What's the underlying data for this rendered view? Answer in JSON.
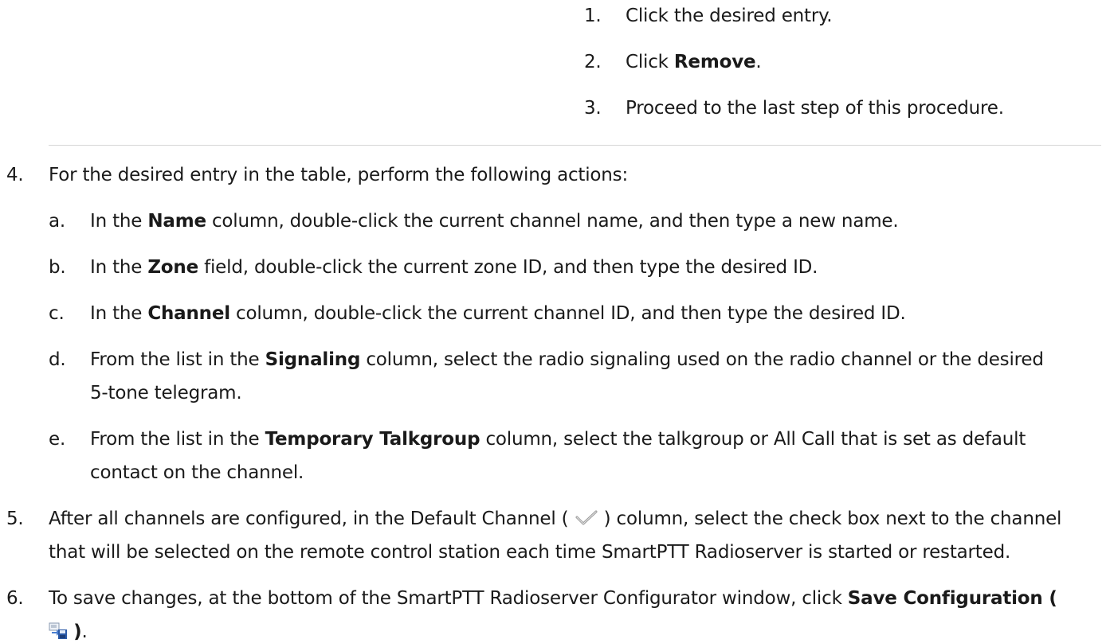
{
  "top_steps": [
    {
      "num": "1.",
      "text": "Click the desired entry."
    },
    {
      "num": "2.",
      "pre": "Click ",
      "bold": "Remove",
      "post": "."
    },
    {
      "num": "3.",
      "text": "Proceed to the last step of this procedure."
    }
  ],
  "step4": {
    "num": "4.",
    "text": "For the desired entry in the table, perform the following actions:",
    "substeps": [
      {
        "letter": "a.",
        "pre": "In the ",
        "bold": "Name",
        "post": " column, double-click the current channel name, and then type a new name."
      },
      {
        "letter": "b.",
        "pre": "In the ",
        "bold": "Zone",
        "post": " field, double-click the current zone ID, and then type the desired ID."
      },
      {
        "letter": "c.",
        "pre": "In the ",
        "bold": "Channel",
        "post": " column, double-click the current channel ID, and then type the desired ID."
      },
      {
        "letter": "d.",
        "pre": "From the list in the ",
        "bold": "Signaling",
        "post": " column, select the radio signaling used on the radio channel or the desired",
        "line2": "5-tone telegram."
      },
      {
        "letter": "e.",
        "pre": "From the list in the ",
        "bold": "Temporary Talkgroup",
        "post": " column, select the talkgroup or All Call that is set as default",
        "line2": "contact on the channel."
      }
    ]
  },
  "step5": {
    "num": "5.",
    "pre": "After all channels are configured, in the Default Channel (",
    "icon": "checkmark-icon",
    "post": ") column, select the check box next to the channel",
    "line2": "that will be selected on the remote control station each time SmartPTT Radioserver is started or restarted."
  },
  "step6": {
    "num": "6.",
    "pre": "To save changes, at the bottom of the SmartPTT Radioserver Configurator window, click ",
    "bold": "Save Configuration (",
    "icon": "save-configuration-icon",
    "bold_end": ")",
    "post": "."
  }
}
